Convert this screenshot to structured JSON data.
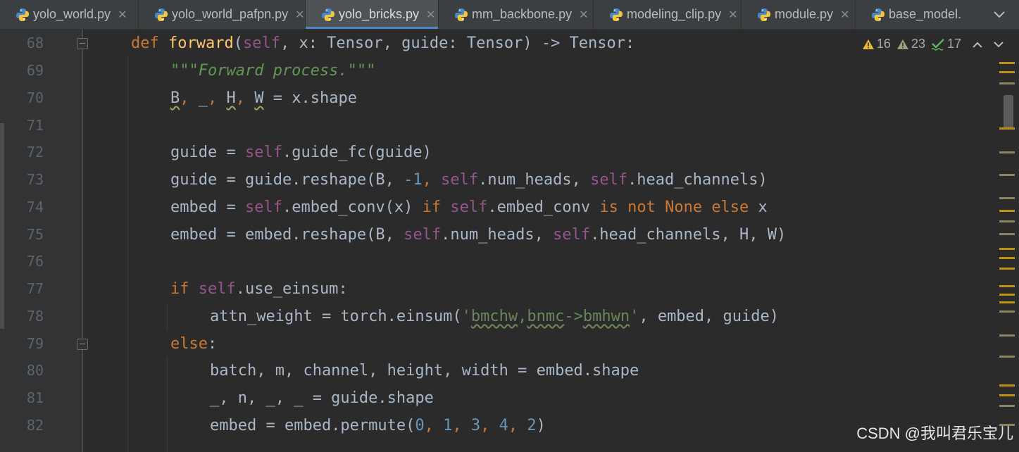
{
  "tabs": [
    {
      "label": "yolo_world.py",
      "active": false,
      "closable": true
    },
    {
      "label": "yolo_world_pafpn.py",
      "active": false,
      "closable": true
    },
    {
      "label": "yolo_bricks.py",
      "active": true,
      "closable": true
    },
    {
      "label": "mm_backbone.py",
      "active": false,
      "closable": true
    },
    {
      "label": "modeling_clip.py",
      "active": false,
      "closable": true
    },
    {
      "label": "module.py",
      "active": false,
      "closable": true
    },
    {
      "label": "base_model.",
      "active": false,
      "closable": false
    }
  ],
  "tab_overflow_icon": "chevron-down-icon",
  "inspections": {
    "warnings": "16",
    "weak_warnings": "23",
    "typos": "17"
  },
  "line_numbers": [
    "68",
    "69",
    "70",
    "71",
    "72",
    "73",
    "74",
    "75",
    "76",
    "77",
    "78",
    "79",
    "80",
    "81",
    "82"
  ],
  "code": {
    "l68": {
      "def": "def",
      "name": "forward",
      "p1": "(",
      "self": "self",
      "rest": ", x: Tensor, guide: Tensor) -> Tensor:"
    },
    "l69": {
      "doc": "\"\"\"Forward process.\"\"\""
    },
    "l70": {
      "B": "B",
      "c1": ", ",
      "u": "_",
      "c2": ", ",
      "H": "H",
      "c3": ", ",
      "W": "W",
      "rest": " = x.shape"
    },
    "l72": {
      "a": "guide = ",
      "self": "self",
      "b": ".guide_fc(guide)"
    },
    "l73": {
      "a": "guide = guide.reshape(B, ",
      "n": "-1",
      "b": ", ",
      "s1": "self",
      "c": ".num_heads, ",
      "s2": "self",
      "d": ".head_channels)"
    },
    "l74": {
      "a": "embed = ",
      "s1": "self",
      "b": ".embed_conv(x) ",
      "if": "if",
      "sp": " ",
      "s2": "self",
      "c": ".embed_conv ",
      "is": "is",
      "sp2": " ",
      "not": "not",
      "sp3": " ",
      "none": "None",
      "sp4": " ",
      "else": "else",
      "d": " x"
    },
    "l75": {
      "a": "embed = embed.reshape(B, ",
      "s1": "self",
      "b": ".num_heads, ",
      "s2": "self",
      "c": ".head_channels, H, W)"
    },
    "l77": {
      "if": "if",
      "sp": " ",
      "self": "self",
      "b": ".use_einsum:"
    },
    "l78": {
      "a": "attn_weight = torch.einsum(",
      "q1": "'",
      "w1": "bmchw",
      "cm": ",",
      "w2": "bnmc",
      "ar": "->",
      "w3": "bmhwn",
      "q2": "'",
      "b": ", embed, guide)"
    },
    "l79": {
      "else": "else",
      "b": ":"
    },
    "l80": {
      "a": "batch, m, channel, height, width = embed.shape"
    },
    "l81": {
      "a": "_, n, _, _ = guide.shape"
    },
    "l82": {
      "a": "embed = embed.permute(",
      "n0": "0",
      "c1": ", ",
      "n1": "1",
      "c2": ", ",
      "n3": "3",
      "c3": ", ",
      "n4": "4",
      "c4": ", ",
      "n2": "2",
      "b": ")"
    }
  },
  "colors": {
    "keyword": "#cc7832",
    "self": "#94558d",
    "function": "#ffc66d",
    "number": "#6897bb",
    "string": "#6a8759",
    "docstring": "#629755",
    "text": "#a9b7c6",
    "warning_marker": "#be9117",
    "active_tab_underline": "#4a88c7"
  },
  "watermark": "CSDN @我叫君乐宝儿"
}
